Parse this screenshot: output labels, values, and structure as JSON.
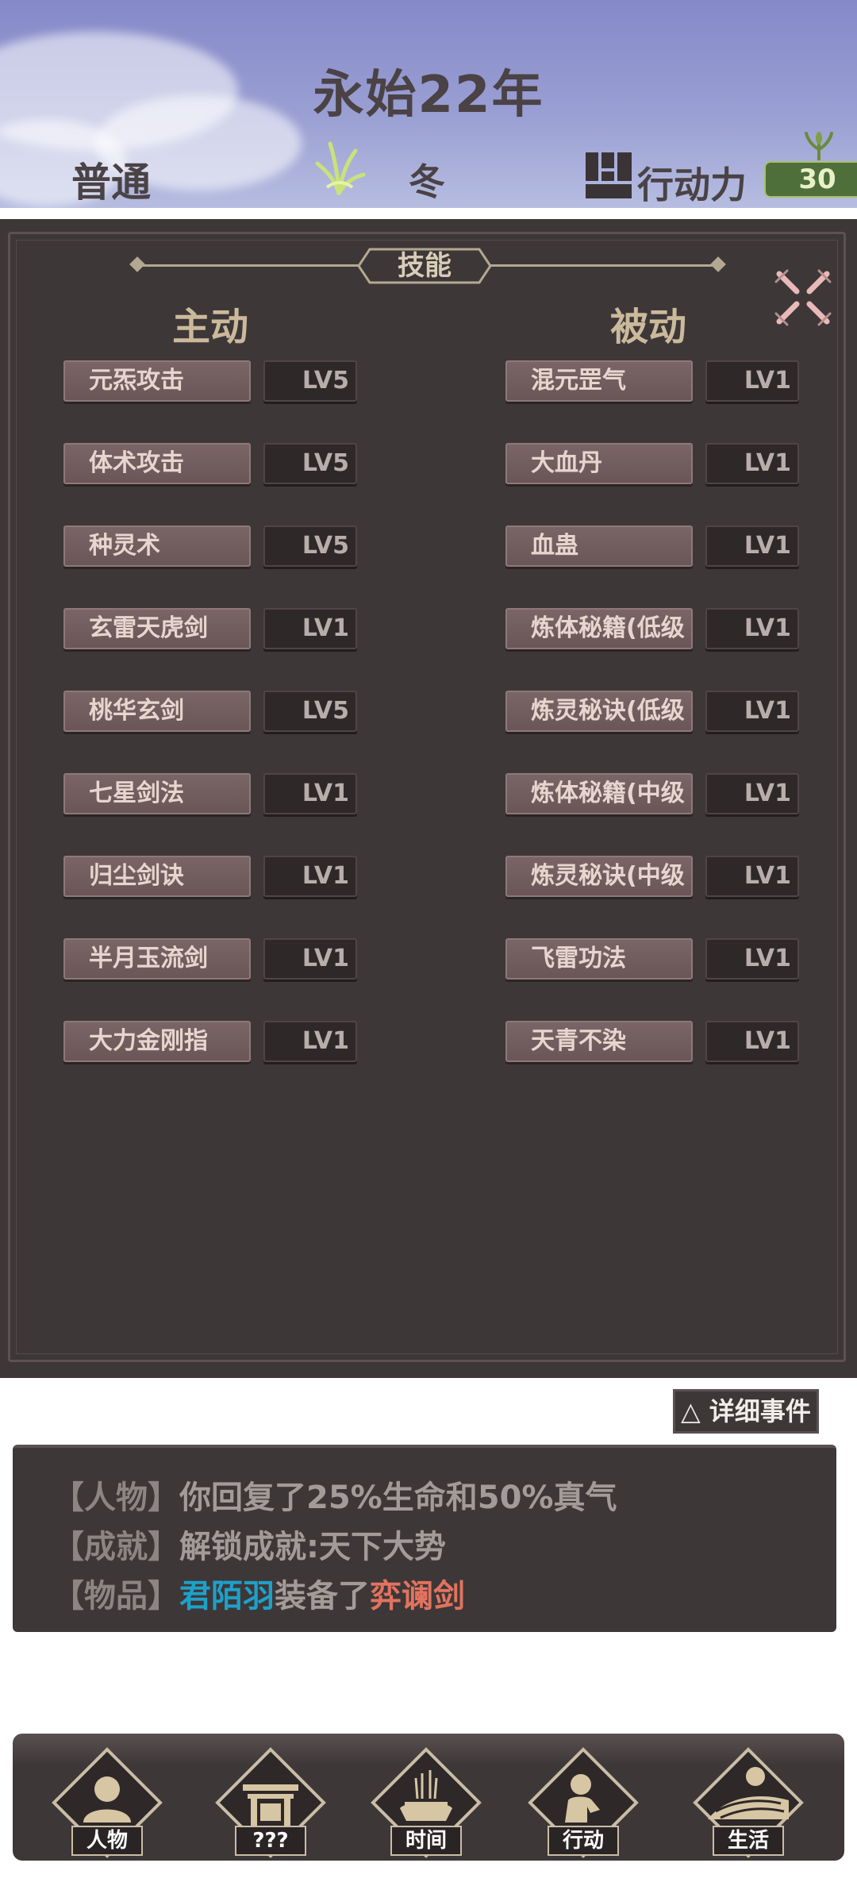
{
  "header": {
    "year": "永始22年",
    "difficulty": "普通",
    "season": "冬",
    "action_label": "行动力",
    "action_points": "30"
  },
  "skills_panel": {
    "title": "技能",
    "active_heading": "主动",
    "passive_heading": "被动",
    "active": [
      {
        "name": "元炁攻击",
        "level": "LV5"
      },
      {
        "name": "体术攻击",
        "level": "LV5"
      },
      {
        "name": "种灵术",
        "level": "LV5"
      },
      {
        "name": "玄雷天虎剑",
        "level": "LV1"
      },
      {
        "name": "桃华玄剑",
        "level": "LV5"
      },
      {
        "name": "七星剑法",
        "level": "LV1"
      },
      {
        "name": "归尘剑诀",
        "level": "LV1"
      },
      {
        "name": "半月玉流剑",
        "level": "LV1"
      },
      {
        "name": "大力金刚指",
        "level": "LV1"
      }
    ],
    "passive": [
      {
        "name": "混元罡气",
        "level": "LV1"
      },
      {
        "name": "大血丹",
        "level": "LV1"
      },
      {
        "name": "血蛊",
        "level": "LV1"
      },
      {
        "name": "炼体秘籍(低级",
        "level": "LV1"
      },
      {
        "name": "炼灵秘诀(低级",
        "level": "LV1"
      },
      {
        "name": "炼体秘籍(中级",
        "level": "LV1"
      },
      {
        "name": "炼灵秘诀(中级",
        "level": "LV1"
      },
      {
        "name": "飞雷功法",
        "level": "LV1"
      },
      {
        "name": "天青不染",
        "level": "LV1"
      }
    ]
  },
  "events": {
    "detail_button": "△ 详细事件",
    "lines": [
      {
        "category": "【人物】",
        "text": "你回复了25%生命和50%真气"
      },
      {
        "category": "【成就】",
        "text": "解锁成就:天下大势"
      },
      {
        "category": "【物品】",
        "actor": "君陌羽",
        "verb": "装备了",
        "item": "弈谰剑"
      }
    ]
  },
  "nav": [
    {
      "label": "人物",
      "icon": "person-icon"
    },
    {
      "label": "???",
      "icon": "shrine-icon"
    },
    {
      "label": "时间",
      "icon": "incense-icon"
    },
    {
      "label": "行动",
      "icon": "sitting-figure-icon"
    },
    {
      "label": "生活",
      "icon": "landscape-icon"
    }
  ],
  "colors": {
    "panel": "#3d3738",
    "header_sky": "#8589c8",
    "name_blue": "#1ea1c9",
    "item_red": "#e2735f",
    "ap_green": "#4f6f3a"
  }
}
